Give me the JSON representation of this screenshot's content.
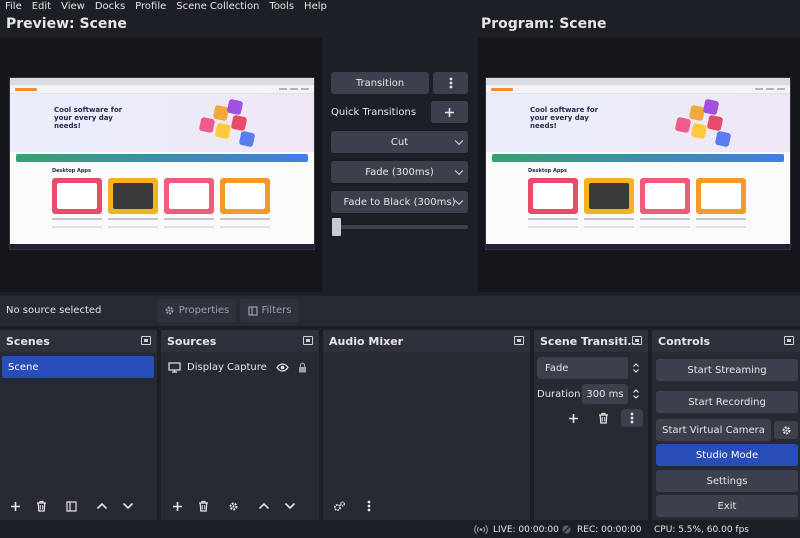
{
  "menu": [
    "File",
    "Edit",
    "View",
    "Docks",
    "Profile",
    "Scene Collection",
    "Tools",
    "Help"
  ],
  "preview": {
    "title": "Preview: Scene"
  },
  "program": {
    "title": "Program: Scene"
  },
  "thumbnail": {
    "hero_text": "Cool software for your every day needs!",
    "section_title": "Desktop Apps"
  },
  "transition_panel": {
    "transition_label": "Transition",
    "quick_transitions_label": "Quick Transitions",
    "items": [
      "Cut",
      "Fade (300ms)",
      "Fade to Black (300ms)"
    ]
  },
  "source_toolbar": {
    "status": "No source selected",
    "properties": "Properties",
    "filters": "Filters"
  },
  "docks": {
    "scenes": {
      "title": "Scenes",
      "items": [
        "Scene"
      ]
    },
    "sources": {
      "title": "Sources",
      "items": [
        "Display Capture"
      ]
    },
    "audio_mixer": {
      "title": "Audio Mixer"
    },
    "scene_transitions": {
      "title": "Scene Transiti...",
      "selected": "Fade",
      "duration_label": "Duration",
      "duration_value": "300 ms"
    },
    "controls": {
      "title": "Controls",
      "buttons": [
        "Start Streaming",
        "Start Recording",
        "Start Virtual Camera",
        "Studio Mode",
        "Settings",
        "Exit"
      ]
    }
  },
  "status_bar": {
    "live": "LIVE: 00:00:00",
    "rec": "REC: 00:00:00",
    "cpu": "CPU: 5.5%, 60.00 fps"
  },
  "colors": {
    "accent": "#284cb8",
    "background": "#1d1f26",
    "panel": "#272a33",
    "button": "#3c404d"
  }
}
